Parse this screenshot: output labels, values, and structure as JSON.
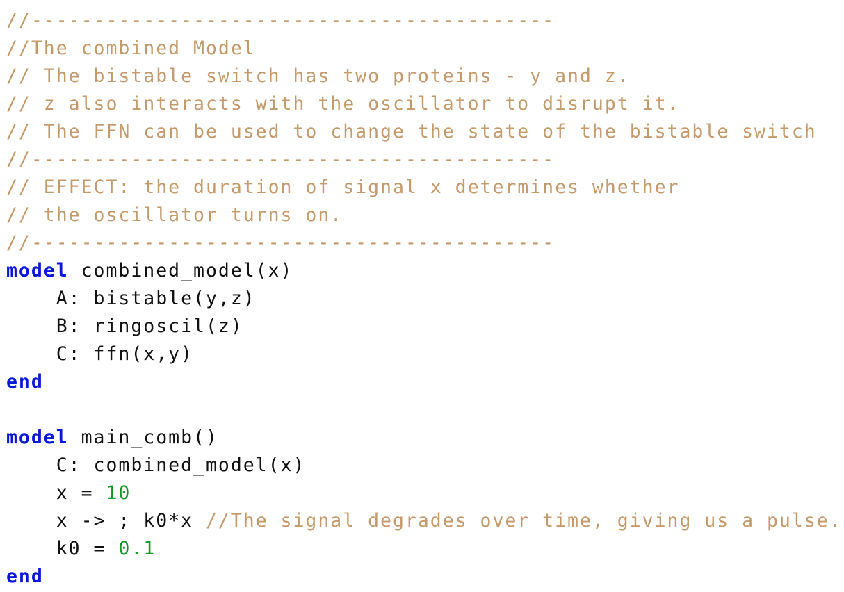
{
  "editor": {
    "lines": [
      [
        {
          "t": "//------------------------------------------",
          "c": "cm"
        }
      ],
      [
        {
          "t": "//The combined Model",
          "c": "cm"
        }
      ],
      [
        {
          "t": "// The bistable switch has two proteins - y and z.",
          "c": "cm"
        }
      ],
      [
        {
          "t": "// z also interacts with the oscillator to disrupt it.",
          "c": "cm"
        }
      ],
      [
        {
          "t": "// The FFN can be used to change the state of the bistable switch",
          "c": "cm"
        }
      ],
      [
        {
          "t": "//------------------------------------------",
          "c": "cm"
        }
      ],
      [
        {
          "t": "// EFFECT: the duration of signal x determines whether",
          "c": "cm"
        }
      ],
      [
        {
          "t": "// the oscillator turns on.",
          "c": "cm"
        }
      ],
      [
        {
          "t": "//------------------------------------------",
          "c": "cm"
        }
      ],
      [
        {
          "t": "model",
          "c": "kw"
        },
        {
          "t": " combined_model(x)",
          "c": "tx"
        }
      ],
      [
        {
          "t": "    A: bistable(y,z)",
          "c": "tx"
        }
      ],
      [
        {
          "t": "    B: ringoscil(z)",
          "c": "tx"
        }
      ],
      [
        {
          "t": "    C: ffn(x,y)",
          "c": "tx"
        }
      ],
      [
        {
          "t": "end",
          "c": "kw"
        }
      ],
      [
        {
          "t": "",
          "c": "tx"
        }
      ],
      [
        {
          "t": "model",
          "c": "kw"
        },
        {
          "t": " main_comb()",
          "c": "tx"
        }
      ],
      [
        {
          "t": "    C: combined_model(x)",
          "c": "tx"
        }
      ],
      [
        {
          "t": "    x = ",
          "c": "tx"
        },
        {
          "t": "10",
          "c": "nm"
        }
      ],
      [
        {
          "t": "    x -> ; k0*x ",
          "c": "tx"
        },
        {
          "t": "//The signal degrades over time, giving us a pulse.",
          "c": "cm"
        }
      ],
      [
        {
          "t": "    k0 = ",
          "c": "tx"
        },
        {
          "t": "0.1",
          "c": "nm"
        }
      ],
      [
        {
          "t": "end",
          "c": "kw"
        }
      ]
    ]
  },
  "colors": {
    "comment": "#c49a6c",
    "keyword": "#0a17d6",
    "number": "#149a2a",
    "text": "#111111",
    "background": "#ffffff"
  }
}
